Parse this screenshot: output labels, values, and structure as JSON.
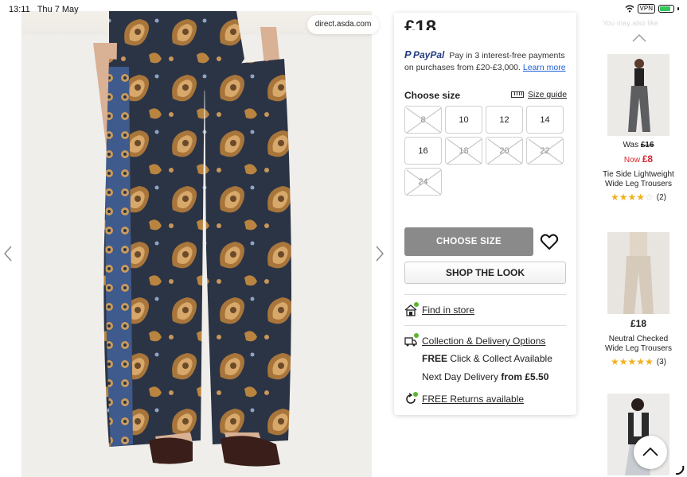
{
  "status_bar": {
    "time": "13:11",
    "date": "Thu 7 May",
    "vpn": "VPN"
  },
  "browser": {
    "url": "direct.asda.com"
  },
  "product": {
    "price_partial": "£18",
    "paypal": {
      "logo": "PayPal",
      "text": "Pay in 3 interest-free payments on purchases from £20-£3,000.",
      "link": "Learn more"
    },
    "size_heading": "Choose size",
    "size_guide": "Size guide",
    "sizes": [
      {
        "label": "8",
        "available": false
      },
      {
        "label": "10",
        "available": true
      },
      {
        "label": "12",
        "available": true
      },
      {
        "label": "14",
        "available": true
      },
      {
        "label": "16",
        "available": true
      },
      {
        "label": "18",
        "available": false
      },
      {
        "label": "20",
        "available": false
      },
      {
        "label": "22",
        "available": false
      },
      {
        "label": "24",
        "available": false
      }
    ],
    "choose_size_button": "CHOOSE SIZE",
    "shop_the_look_button": "SHOP THE LOOK",
    "find_in_store": "Find in store",
    "collection_link": "Collection & Delivery Options",
    "collect_free": "FREE",
    "collect_rest": "Click & Collect Available",
    "next_day_prefix": "Next Day Delivery",
    "next_day_price": "from £5.50",
    "returns": "FREE Returns available"
  },
  "recommendations": {
    "heading": "You may also like",
    "items": [
      {
        "was_label": "Was",
        "was_price": "£16",
        "now_label": "Now",
        "now_price": "£8",
        "name": "Tie Side Lightweight Wide Leg Trousers",
        "rating": 3.5,
        "reviews": "(2)"
      },
      {
        "price": "£18",
        "name": "Neutral Checked Wide Leg Trousers",
        "rating": 5,
        "reviews": "(3)"
      },
      {
        "name": ""
      }
    ]
  },
  "icons": {
    "prev": "chevron-left-icon",
    "next": "chevron-right-icon",
    "wishlist": "heart-icon",
    "scroll_top": "chevron-up-icon"
  },
  "colors": {
    "accent_green": "#5bb531",
    "sale_red": "#d6262d",
    "star": "#f1b11c",
    "button_grey": "#8a8a8a",
    "paypal_dark": "#253b80",
    "paypal_light": "#179bd7"
  }
}
